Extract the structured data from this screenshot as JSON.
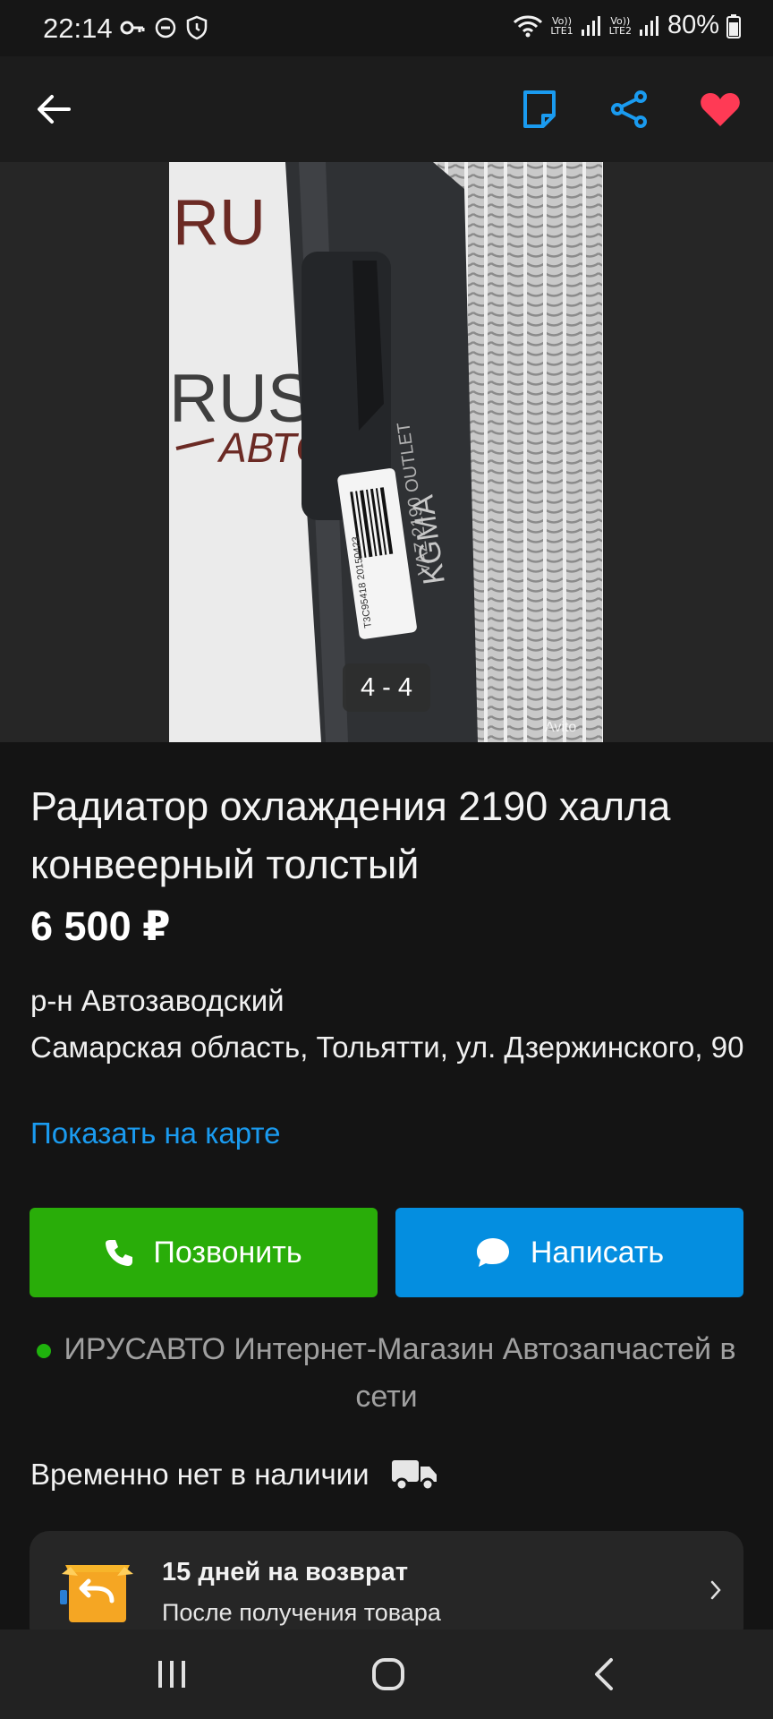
{
  "status_bar": {
    "time": "22:14",
    "battery": "80%",
    "sim1_top": "Vo))",
    "sim1_bottom": "LTE1",
    "sim2_top": "Vo))",
    "sim2_bottom": "LTE2",
    "icons": [
      "key-icon",
      "dnd-icon",
      "shield-icon",
      "wifi-icon",
      "signal-icon",
      "battery-icon"
    ]
  },
  "app_bar": {
    "icons": [
      "back-arrow-icon",
      "note-icon",
      "share-icon",
      "heart-icon"
    ]
  },
  "colors": {
    "background": "#141414",
    "accent_blue": "#1a9bf0",
    "call_green": "#29ad09",
    "write_blue": "#048ee0",
    "favorite_red": "#ff3a55",
    "online_green": "#1fb20d"
  },
  "gallery": {
    "counter": "4 - 4",
    "photo_texts": {
      "logo_top": "RU",
      "logo_mid": "RUS-",
      "logo_small": "АВТО",
      "marking": "KGMA",
      "outlet": "VAZ 2190 OUTLET",
      "barcode_digits": "T3C95418 20150423",
      "watermark": "Avito"
    }
  },
  "listing": {
    "title": "Радиатор охлаждения 2190 халла конвеерный толстый",
    "price": "6 500 ₽",
    "district": "р-н Автозаводский",
    "address": "Самарская область, Тольятти, ул. Дзержинского, 90",
    "map_link": "Показать на карте"
  },
  "actions": {
    "call_label": "Позвонить",
    "write_label": "Написать"
  },
  "seller": {
    "name": "ИРУСАВТО Интернет-Магазин Автозапчастей в сети"
  },
  "availability": {
    "label": "Временно нет в наличии"
  },
  "return_info": {
    "title": "15 дней на возврат",
    "subtitle": "После получения товара"
  },
  "nav_bar": {
    "icons": [
      "recents-icon",
      "home-icon",
      "back-icon"
    ]
  }
}
